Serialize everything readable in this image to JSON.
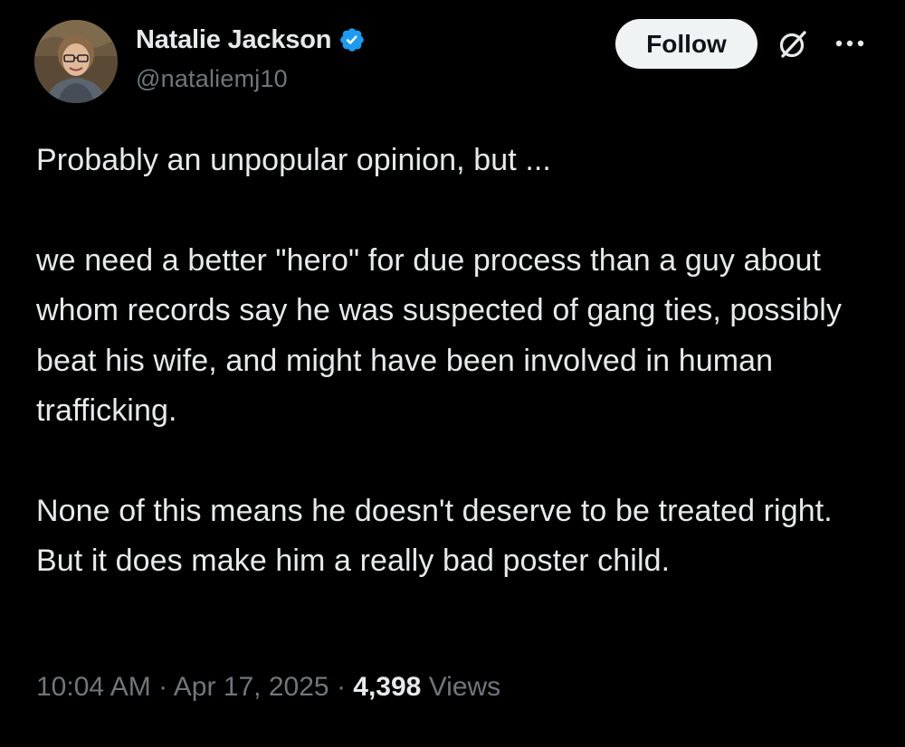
{
  "author": {
    "display_name": "Natalie Jackson",
    "handle": "@nataliemj10",
    "verified": true,
    "verified_color": "#1d9bf0"
  },
  "actions": {
    "follow_label": "Follow",
    "grok_icon": "grok-icon",
    "more_icon": "more-options-icon"
  },
  "tweet": {
    "paragraphs": [
      "Probably an unpopular opinion, but ...",
      "we need a better \"hero\" for due process than a guy about whom records say he was suspected of gang ties, possibly beat his wife, and might have been involved in human trafficking.",
      "None of this means he doesn't deserve to be treated right. But it does make him a really bad poster child."
    ]
  },
  "meta": {
    "time": "10:04 AM",
    "separator": "·",
    "date": "Apr 17, 2025",
    "views_count": "4,398",
    "views_label": "Views"
  },
  "colors": {
    "background": "#000000",
    "text": "#e7e9ea",
    "secondary": "#71767b",
    "button_bg": "#eff3f4",
    "button_text": "#0f1419"
  }
}
